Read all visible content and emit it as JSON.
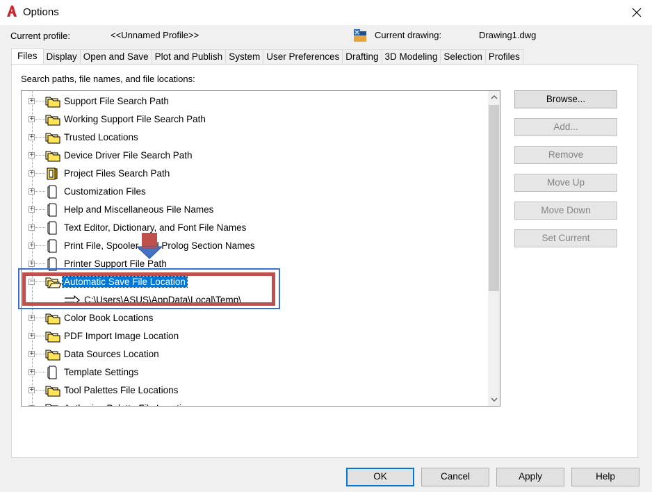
{
  "window": {
    "title": "Options"
  },
  "profile": {
    "current_profile_label": "Current profile:",
    "current_profile_value": "<<Unnamed Profile>>",
    "current_drawing_label": "Current drawing:",
    "current_drawing_value": "Drawing1.dwg"
  },
  "tabs": [
    {
      "label": "Files",
      "active": true
    },
    {
      "label": "Display"
    },
    {
      "label": "Open and Save"
    },
    {
      "label": "Plot and Publish"
    },
    {
      "label": "System"
    },
    {
      "label": "User Preferences"
    },
    {
      "label": "Drafting"
    },
    {
      "label": "3D Modeling"
    },
    {
      "label": "Selection"
    },
    {
      "label": "Profiles"
    }
  ],
  "panel": {
    "caption": "Search paths, file names, and file locations:"
  },
  "tree": {
    "items": [
      {
        "label": "Support File Search Path",
        "icon": "folder-stack-icon"
      },
      {
        "label": "Working Support File Search Path",
        "icon": "folder-stack-icon"
      },
      {
        "label": "Trusted Locations",
        "icon": "folder-stack-icon"
      },
      {
        "label": "Device Driver File Search Path",
        "icon": "folder-stack-icon"
      },
      {
        "label": "Project Files Search Path",
        "icon": "project-icon"
      },
      {
        "label": "Customization Files",
        "icon": "document-icon"
      },
      {
        "label": "Help and Miscellaneous File Names",
        "icon": "document-icon"
      },
      {
        "label": "Text Editor, Dictionary, and Font File Names",
        "icon": "document-icon"
      },
      {
        "label": "Print File, Spooler, and Prolog Section Names",
        "icon": "document-icon"
      },
      {
        "label": "Printer Support File Path",
        "icon": "document-icon"
      },
      {
        "label": "Automatic Save File Location",
        "icon": "folder-open-icon",
        "expanded": true,
        "selected": true
      },
      {
        "child": "C:\\Users\\ASUS\\AppData\\Local\\Temp\\"
      },
      {
        "label": "Color Book Locations",
        "icon": "folder-stack-icon"
      },
      {
        "label": "PDF Import Image Location",
        "icon": "folder-stack-icon"
      },
      {
        "label": "Data Sources Location",
        "icon": "folder-stack-icon"
      },
      {
        "label": "Template Settings",
        "icon": "document-icon"
      },
      {
        "label": "Tool Palettes File Locations",
        "icon": "folder-stack-icon"
      },
      {
        "label": "Authoring Palette File Locations",
        "icon": "folder-stack-icon"
      }
    ]
  },
  "side_buttons": {
    "browse": "Browse...",
    "add": "Add...",
    "remove": "Remove",
    "move_up": "Move Up",
    "move_down": "Move Down",
    "set_current": "Set Current"
  },
  "footer": {
    "ok": "OK",
    "cancel": "Cancel",
    "apply": "Apply",
    "help": "Help"
  },
  "colors": {
    "accent": "#0078d7",
    "highlight_red": "#c0504d",
    "highlight_blue": "#3b6fd6",
    "app_icon_red": "#c8262e"
  }
}
